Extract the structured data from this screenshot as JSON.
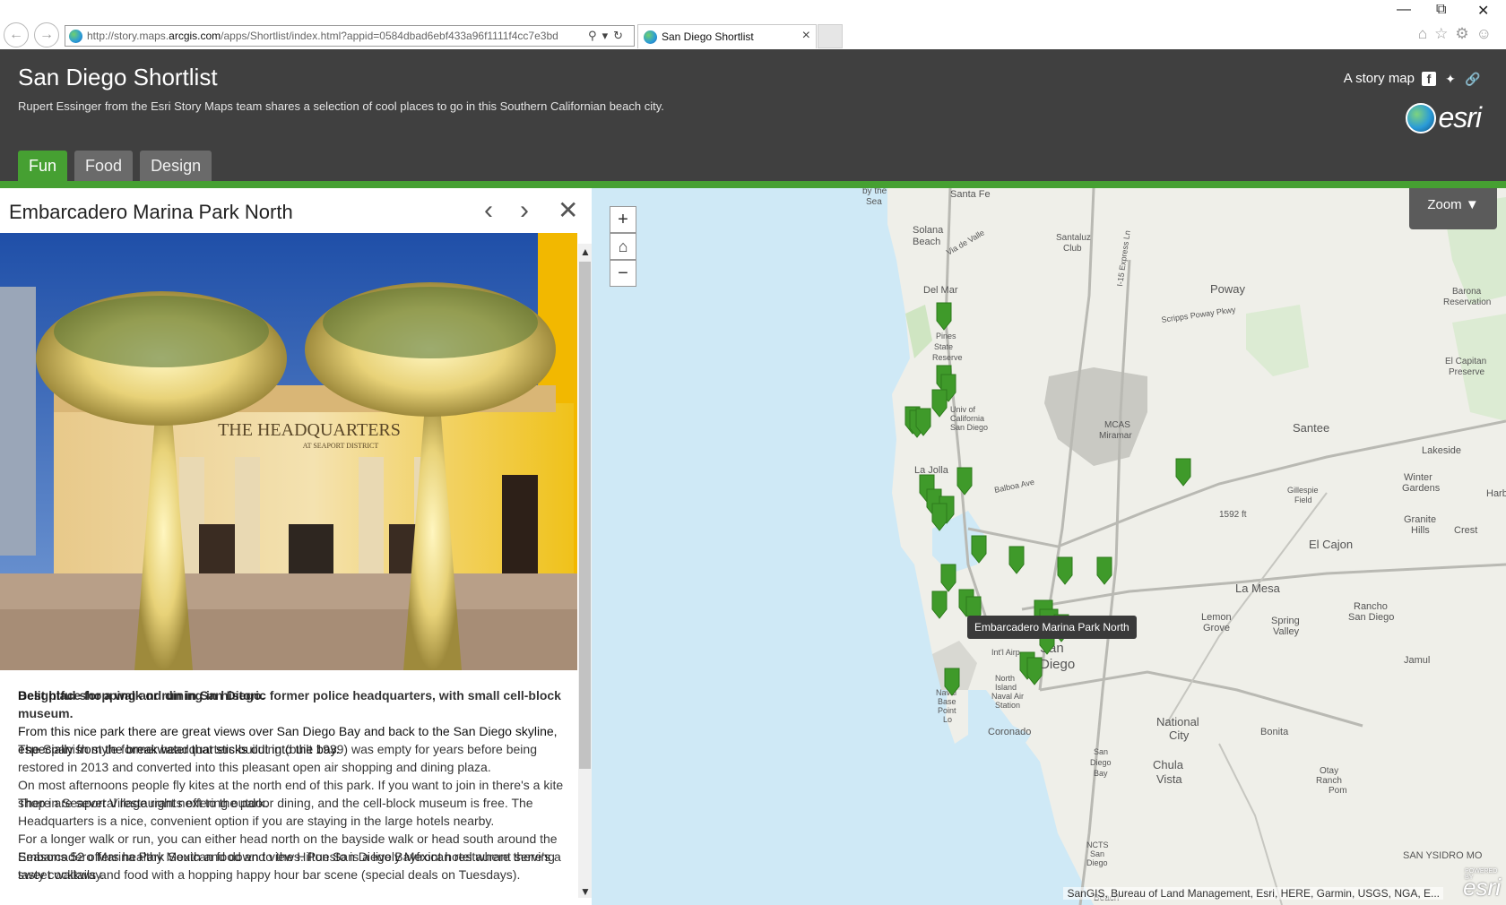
{
  "browser": {
    "url_prefix": "http://story.maps.",
    "url_domain": "arcgis.com",
    "url_suffix": "/apps/Shortlist/index.html?appid=0584dbad6ebf433a96f1111f4cc7e3bd",
    "tab_title": "San Diego Shortlist"
  },
  "header": {
    "title": "San Diego Shortlist",
    "subtitle": "Rupert Essinger from the Esri Story Maps team shares a selection of cool places to go in this Southern Californian beach city.",
    "story_map_label": "A story map",
    "logo_text": "esri"
  },
  "tabs": [
    {
      "label": "Fun"
    },
    {
      "label": "Food"
    },
    {
      "label": "Design"
    }
  ],
  "panel": {
    "place_title": "Embarcadero Marina Park North",
    "photo_sign": "THE HEADQUARTERS",
    "photo_sign_sub": "AT SEAPORT DISTRICT",
    "description": [
      "Best place for a walk or run in San Diego.",
      "Delightful shopping and dining in historic former police headquarters, with small cell-block museum.",
      "From this nice park there are great views over San Diego Bay and back to the San Diego skyline, especially from the breakwater that sticks out into the bay.",
      "The Spanish style former headquarters building (built 1939) was empty for years before being restored in 2013 and converted into this pleasant open air shopping and dining plaza.",
      "On most afternoons people fly kites at the north end of this park. If you want to join in there's a kite shop in Seaport Village right next to the park.",
      "There are several restaurants offering outdoor dining, and the cell-block museum is free. The Headquarters is a nice, convenient option if you are staying in the large hotels nearby.",
      "For a longer walk or run, you can either head north on the bayside walk or head south around the Embarcadero Marina Park South and down to the Hilton San Diego Bayfront hotel where there's a sweet walkway.",
      "Seasons 52 offers healthy Mexican food and views. Puesto is a lively Mexican restaurant serving tasty cocktails and food with a hopping happy hour bar scene (special deals on Tuesdays)."
    ]
  },
  "map": {
    "zoom_label": "Zoom ▼",
    "tooltip": "Embarcadero Marina Park North",
    "attribution": "SanGIS, Bureau of Land Management, Esri, HERE, Garmin, USGS, NGA, E...",
    "powered_small": "POWERED BY",
    "powered_logo": "esri",
    "labels": {
      "by_the_sea": "by the",
      "sea": "Sea",
      "santa_fe": "Santa Fe",
      "solana": "Solana",
      "beach": "Beach",
      "santaluz": "Santaluz",
      "club": "Club",
      "del_mar": "Del Mar",
      "poway": "Poway",
      "barona": "Barona",
      "reservation": "Reservation",
      "pines": "Pines",
      "state": "State",
      "reserve": "Reserve",
      "univ": "Univ of",
      "california": "California",
      "san_diego_small": "San Diego",
      "mcas": "MCAS",
      "miramar": "Miramar",
      "el_capitan": "El Capitan",
      "preserve": "Preserve",
      "santee": "Santee",
      "lakeside": "Lakeside",
      "la_jolla": "La Jolla",
      "winter": "Winter",
      "gardens": "Gardens",
      "gillespie": "Gillespie",
      "field": "Field",
      "elev": "1592 ft",
      "granite": "Granite",
      "hills": "Hills",
      "harbison": "Harb",
      "crest": "Crest",
      "el_cajon": "El Cajon",
      "la_mesa": "La Mesa",
      "lemon": "Lemon",
      "grove": "Grove",
      "spring": "Spring",
      "valley": "Valley",
      "rancho": "Rancho",
      "rancho_sd": "San Diego",
      "san": "San",
      "diego": "Diego",
      "intl_airport": "Int'l Airp",
      "north": "North",
      "island": "Island",
      "naval_air": "Naval Air",
      "station": "Station",
      "naval": "Naval",
      "base": "Base",
      "point": "Point",
      "loma": "Lo",
      "coronado": "Coronado",
      "national": "National",
      "city": "City",
      "bonita": "Bonita",
      "jamul": "Jamul",
      "san_diego_bay": "San",
      "diego_bay": "Diego",
      "bay": "Bay",
      "chula": "Chula",
      "vista": "Vista",
      "otay": "Otay",
      "ranch": "Ranch",
      "pom": "Pom",
      "ncts": "NCTS",
      "ncts_sd": "San",
      "ncts_diego": "Diego",
      "san_ysidro": "SAN YSIDRO MO",
      "scripps": "Scripps Poway Pkwy",
      "via_de_valle": "Via de Valle",
      "balboa": "Balboa Ave",
      "express": "I-15 Express Ln",
      "beach_bottom": "Beach"
    }
  }
}
